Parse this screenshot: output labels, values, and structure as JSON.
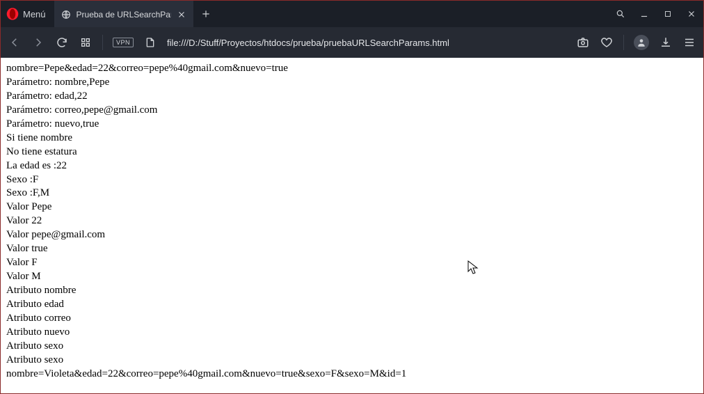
{
  "window": {
    "menu_label": "Menú",
    "tab_title": "Prueba de URLSearchParam",
    "url": "file:///D:/Stuff/Proyectos/htdocs/prueba/pruebaURLSearchParams.html",
    "vpn_label": "VPN"
  },
  "page": {
    "lines": [
      "nombre=Pepe&edad=22&correo=pepe%40gmail.com&nuevo=true",
      "Parámetro: nombre,Pepe",
      "Parámetro: edad,22",
      "Parámetro: correo,pepe@gmail.com",
      "Parámetro: nuevo,true",
      "Si tiene nombre",
      "No tiene estatura",
      "La edad es :22",
      "Sexo :F",
      "Sexo :F,M",
      "Valor Pepe",
      "Valor 22",
      "Valor pepe@gmail.com",
      "Valor true",
      "Valor F",
      "Valor M",
      "Atributo nombre",
      "Atributo edad",
      "Atributo correo",
      "Atributo nuevo",
      "Atributo sexo",
      "Atributo sexo",
      "nombre=Violeta&edad=22&correo=pepe%40gmail.com&nuevo=true&sexo=F&sexo=M&id=1"
    ]
  }
}
